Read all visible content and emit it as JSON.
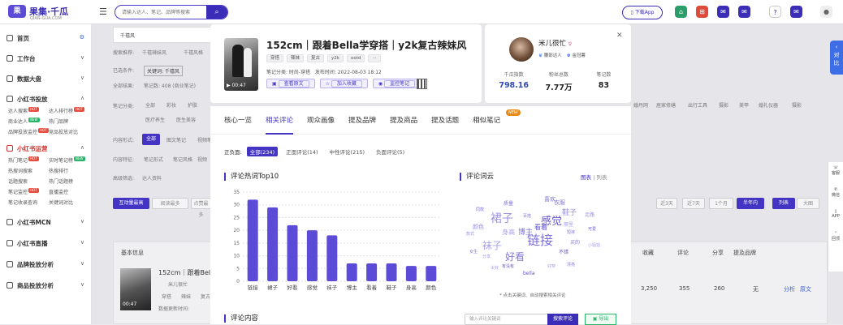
{
  "topbar": {
    "logo_mark": "果",
    "logo_text": "果集·千瓜",
    "logo_sub": "QIAN-GUA.COM",
    "search_placeholder": "请输入达人、笔记、品牌等搜索",
    "download_app": "下载App"
  },
  "sidebar": {
    "sections": [
      {
        "label": "首页"
      },
      {
        "label": "工作台"
      },
      {
        "label": "数据大盘"
      },
      {
        "label": "小红书投放"
      }
    ],
    "tf_items": [
      "达人搜索",
      "达人排行榜",
      "商业达人",
      "热门品牌",
      "品牌投放监控",
      "竞品投放对比"
    ],
    "yy_label": "小红书运营",
    "yy_items": [
      "热门笔记",
      "实时笔记榜",
      "热搜词搜索",
      "热搜排行",
      "话题搜索",
      "热门话题榜",
      "笔记监控",
      "直播监控",
      "笔记收录查询",
      "关键词对比"
    ],
    "more_sections": [
      {
        "label": "小红书MCN"
      },
      {
        "label": "小红书直播"
      },
      {
        "label": "品牌投放分析"
      },
      {
        "label": "商品投放分析"
      }
    ]
  },
  "background": {
    "keyword": "千禧风",
    "search_recommend": "搜索推荐:",
    "rec_items": [
      "千禧辣妹风",
      "千禧风格"
    ],
    "selected": "已选条件:",
    "selected_value": "关键词: 千禧风",
    "total": "全部结果:",
    "total_value": "笔记数: 408 (商业笔记)",
    "note_category": "笔记分类:",
    "categories": [
      "全部",
      "彩妆",
      "护肤",
      "医疗养生",
      "医生美容"
    ],
    "content_form": "内容形式:",
    "forms": [
      "全部",
      "图文笔记",
      "视频笔记"
    ],
    "content_feature": "内容特征:",
    "features": [
      "笔记形式",
      "笔记风格",
      "视频"
    ],
    "advanced": "高级筛选:",
    "advanced_value": "达人资料",
    "sort_buttons": [
      "互动量最高",
      "阅读最多",
      "点赞最多"
    ],
    "time_buttons": [
      "近3天",
      "近7天",
      "1个月",
      "半年内"
    ],
    "view_buttons": [
      "列表",
      "大图"
    ],
    "right_cats": [
      "婚丹网",
      "居家修缮",
      "出行工具",
      "摄影",
      "美甲",
      "婚礼仪器",
      "摄影"
    ],
    "table_headers": [
      "基本信息",
      "收藏",
      "评论",
      "分享",
      "提及品牌"
    ],
    "row": {
      "title": "152cm｜跟着Bella",
      "author": "米儿很忙",
      "tags": [
        "穿搭",
        "辣妹",
        "复古"
      ],
      "dur": "00:47",
      "update": "数据更新时间:",
      "collect": "3,250",
      "comment": "355",
      "share": "260",
      "brand": "无",
      "ops": [
        "分析",
        "原文"
      ]
    }
  },
  "right_rail": {
    "tab": "关\n对\n比",
    "tools": [
      "客服",
      "微信",
      "APP",
      "回顶"
    ]
  },
  "note": {
    "title": "152cm｜跟着Bella学穿搭｜y2k复古辣妹风",
    "tags": [
      "穿搭",
      "辣妹",
      "复古",
      "y2k",
      "ootd",
      "···"
    ],
    "category_label": "笔记分类: 时尚-穿搭",
    "publish_label": "发布时间: 2022-08-03 18:12",
    "duration": "00:47",
    "actions": [
      "查看原文",
      "加入收藏",
      "监控笔记"
    ]
  },
  "author": {
    "name": "米儿很忙",
    "level": "腰部达人",
    "badge": "金冠薯",
    "stats": [
      {
        "label": "千瓜指数",
        "value": "798.16"
      },
      {
        "label": "粉丝总数",
        "value": "7.77万"
      },
      {
        "label": "笔记数",
        "value": "83"
      }
    ]
  },
  "modal": {
    "tabs": [
      "核心一览",
      "相关评论",
      "观众画像",
      "提及品牌",
      "提及商品",
      "提及话题",
      "相似笔记"
    ],
    "new_badge": "NEW",
    "filter_label": "正负面:",
    "filter_options": [
      "全部(234)",
      "正面评论(14)",
      "中性评论(215)",
      "负面评论(5)"
    ],
    "hotwords_title": "评论热词Top10",
    "cloud_title": "评论词云",
    "view_chart": "图表",
    "view_list": "列表",
    "cloud_note": "* 点击关键词、自动搜索相关评论",
    "comments_title": "评论内容",
    "comment_placeholder": "输入评论关键词",
    "comment_search": "搜索评论",
    "export": "导出"
  },
  "chart_data": {
    "type": "bar",
    "title": "评论热词Top10",
    "categories": [
      "链接",
      "裙子",
      "好看",
      "感觉",
      "袜子",
      "博主",
      "看着",
      "鞋子",
      "身高",
      "颜色"
    ],
    "values": [
      32,
      29,
      22,
      20,
      18,
      7,
      7,
      7,
      6,
      6
    ],
    "ylim": [
      0,
      35
    ],
    "yticks": [
      0,
      5,
      10,
      15,
      20,
      25,
      30,
      35
    ],
    "bar_color": "#5b4bd6",
    "grid": true
  },
  "word_cloud": [
    {
      "word": "链接",
      "size": 16
    },
    {
      "word": "裙子",
      "size": 14
    },
    {
      "word": "感觉",
      "size": 13
    },
    {
      "word": "袜子",
      "size": 12
    },
    {
      "word": "好看",
      "size": 12
    },
    {
      "word": "博主",
      "size": 9
    },
    {
      "word": "鞋子",
      "size": 9
    },
    {
      "word": "看着",
      "size": 8
    },
    {
      "word": "身高",
      "size": 8
    },
    {
      "word": "衣服",
      "size": 7
    },
    {
      "word": "喜欢",
      "size": 7
    },
    {
      "word": "颜色",
      "size": 7
    },
    {
      "word": "bella",
      "size": 6
    },
    {
      "word": "哪里",
      "size": 6
    },
    {
      "word": "买的",
      "size": 6
    },
    {
      "word": "质量",
      "size": 6
    },
    {
      "word": "走路",
      "size": 6
    },
    {
      "word": "不错",
      "size": 6
    },
    {
      "word": "太好",
      "size": 5
    },
    {
      "word": "短袜",
      "size": 5
    },
    {
      "word": "女生",
      "size": 5
    },
    {
      "word": "分享",
      "size": 5
    },
    {
      "word": "可爱",
      "size": 5
    },
    {
      "word": "小姐姐",
      "size": 5
    },
    {
      "word": "百搭",
      "size": 5
    },
    {
      "word": "同款",
      "size": 5
    },
    {
      "word": "款式",
      "size": 5
    },
    {
      "word": "有没有",
      "size": 5
    },
    {
      "word": "好穿",
      "size": 5
    },
    {
      "word": "漂亮",
      "size": 5
    }
  ]
}
